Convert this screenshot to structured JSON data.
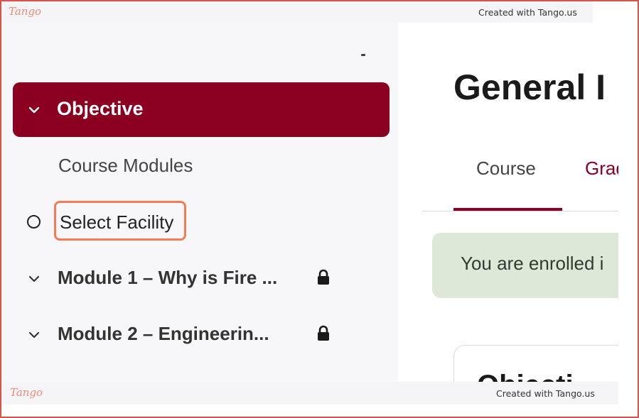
{
  "tango": {
    "logo": "Tango",
    "credit": "Created with Tango.us"
  },
  "sidebar": {
    "active_section": "Objective",
    "course_modules": "Course Modules",
    "select_facility": "Select Facility",
    "modules": [
      {
        "label": "Module 1 – Why is Fire ...",
        "locked": true
      },
      {
        "label": "Module 2 – Engineerin...",
        "locked": true
      }
    ]
  },
  "main": {
    "title": "General I",
    "tabs": [
      {
        "label": "Course",
        "active": true
      },
      {
        "label": "Grad",
        "active": false
      }
    ],
    "notice": "You are enrolled i",
    "card_heading": "Objecti"
  },
  "colors": {
    "accent": "#8b0020",
    "highlight": "#f47b52",
    "notice_bg": "#dde8d9"
  }
}
